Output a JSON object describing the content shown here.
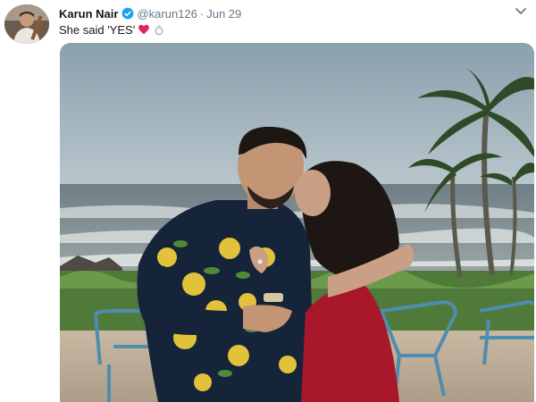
{
  "tweet": {
    "author_name": "Karun Nair",
    "handle": "@karun126",
    "separator": "·",
    "date": "Jun 29",
    "text": "She said 'YES'"
  },
  "icons": {
    "verified": "verified-badge-icon",
    "heart": "red-heart-emoji",
    "ring": "ring-emoji",
    "menu": "chevron-down-icon"
  },
  "colors": {
    "verified_blue": "#1da1f2",
    "heart_red": "#e0245e",
    "secondary_text": "#657786",
    "primary_text": "#14171a"
  }
}
